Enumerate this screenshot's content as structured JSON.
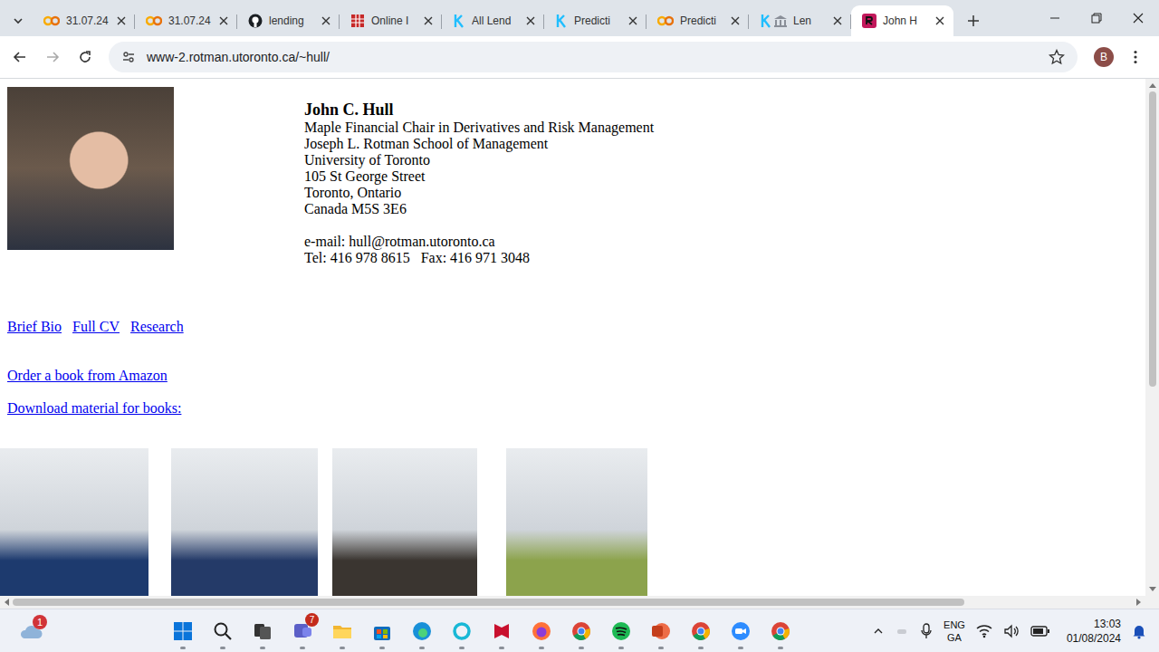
{
  "tabs": [
    {
      "label": "31.07.24",
      "kind": "colab",
      "selected": false
    },
    {
      "label": "31.07.24",
      "kind": "colab",
      "selected": false
    },
    {
      "label": "lending",
      "kind": "github",
      "selected": false
    },
    {
      "label": "Online I",
      "kind": "sheet",
      "selected": false
    },
    {
      "label": "All Lend",
      "kind": "kaggle",
      "selected": false
    },
    {
      "label": "Predicti",
      "kind": "kaggle",
      "selected": false
    },
    {
      "label": "Predicti",
      "kind": "colab",
      "selected": false
    },
    {
      "label": "Len",
      "kind": "kaggle-bank",
      "selected": false
    },
    {
      "label": "John H",
      "kind": "rotman",
      "selected": true
    }
  ],
  "address_bar": {
    "url": "www-2.rotman.utoronto.ca/~hull/",
    "profile": "B"
  },
  "page": {
    "name": "John C. Hull",
    "address_lines": [
      "Maple Financial Chair in Derivatives and Risk Management",
      "Joseph L. Rotman School of Management",
      "University of Toronto",
      "105 St George Street",
      "Toronto, Ontario",
      "Canada M5S 3E6"
    ],
    "email": "e-mail: hull@rotman.utoronto.ca",
    "phone": "Tel: 416 978 8615   Fax: 416 971 3048",
    "links": [
      "Brief Bio",
      "Full CV",
      "Research"
    ],
    "order_link": "Order a book from Amazon",
    "download_link": "Download material for books:",
    "books": [
      {
        "color": "#1d3a6e"
      },
      {
        "color": "#243a68"
      },
      {
        "color": "#3a3530"
      },
      {
        "color": "#8ca34c"
      }
    ]
  },
  "taskbar": {
    "weather_badge": "1",
    "apps": [
      {
        "kind": "windows"
      },
      {
        "kind": "search"
      },
      {
        "kind": "taskview"
      },
      {
        "kind": "teams",
        "badge": "7"
      },
      {
        "kind": "explorer"
      },
      {
        "kind": "store"
      },
      {
        "kind": "edge"
      },
      {
        "kind": "cortana"
      },
      {
        "kind": "mcafee"
      },
      {
        "kind": "firefox"
      },
      {
        "kind": "chrome"
      },
      {
        "kind": "spotify"
      },
      {
        "kind": "powerpoint"
      },
      {
        "kind": "chrome"
      },
      {
        "kind": "zoom"
      },
      {
        "kind": "chrome"
      }
    ],
    "language": "ENG",
    "layout": "GA",
    "time": "13:03",
    "date": "01/08/2024"
  }
}
